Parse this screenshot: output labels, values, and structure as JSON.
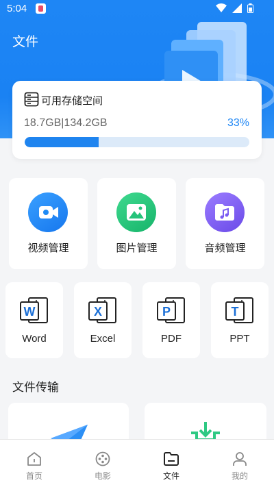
{
  "status_bar": {
    "time": "5:04"
  },
  "page": {
    "title": "文件"
  },
  "storage": {
    "label": "可用存储空间",
    "used_text": "18.7GB|134.2GB",
    "percent_text": "33%",
    "percent": 33
  },
  "categories": [
    {
      "label": "视频管理",
      "icon": "video-icon",
      "color": "#1e8af6"
    },
    {
      "label": "图片管理",
      "icon": "image-icon",
      "color": "#25c37a"
    },
    {
      "label": "音频管理",
      "icon": "music-icon",
      "color": "#7a5cf2"
    }
  ],
  "documents": [
    {
      "label": "Word",
      "letter": "W",
      "color": "#1b6fd6"
    },
    {
      "label": "Excel",
      "letter": "X",
      "color": "#1b6fd6"
    },
    {
      "label": "PDF",
      "letter": "P",
      "color": "#1b6fd6"
    },
    {
      "label": "PPT",
      "letter": "T",
      "color": "#1b6fd6"
    }
  ],
  "transfer": {
    "title": "文件传输",
    "items": [
      {
        "icon": "send-icon"
      },
      {
        "icon": "receive-icon"
      }
    ]
  },
  "tabs": [
    {
      "label": "首页",
      "icon": "home-icon"
    },
    {
      "label": "电影",
      "icon": "movie-icon"
    },
    {
      "label": "文件",
      "icon": "folder-icon",
      "active": true
    },
    {
      "label": "我的",
      "icon": "profile-icon"
    }
  ],
  "colors": {
    "primary": "#1e86f5",
    "text": "#222222",
    "muted": "#888888"
  }
}
